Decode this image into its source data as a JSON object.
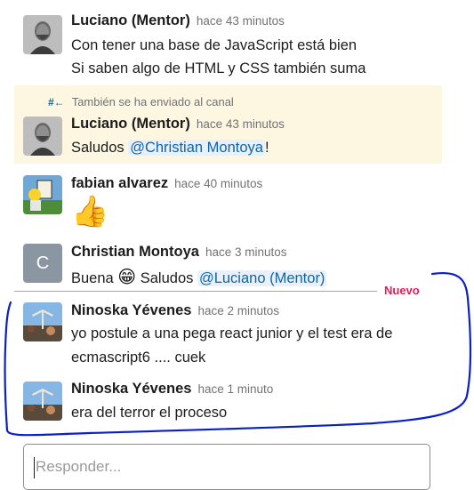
{
  "messages": [
    {
      "author": "Luciano (Mentor)",
      "time": "hace 43 minutos",
      "lines": [
        "Con tener una base de JavaScript está bien",
        "Si saben algo de HTML y CSS también suma"
      ],
      "avatar": "photo"
    },
    {
      "shared_note": "También se ha enviado al canal",
      "author": "Luciano (Mentor)",
      "time": "hace 43 minutos",
      "text_before": "Saludos ",
      "mention": "@Christian Montoya",
      "text_after": "!",
      "avatar": "photo",
      "highlighted": true
    },
    {
      "author": "fabian alvarez",
      "time": "hace 40 minutos",
      "emoji": "👍",
      "emoji_name": "thumbs-up-emoji",
      "avatar": "simpsons-photo"
    },
    {
      "author": "Christian Montoya",
      "time": "hace 3 minutos",
      "text_before": "Buena ",
      "emoji": "😁",
      "text_middle": " Saludos ",
      "mention": "@Luciano (Mentor)",
      "avatar_letter": "C",
      "avatar_color": "#8a97a3"
    },
    {
      "author": "Ninoska Yévenes",
      "time": "hace 2 minutos",
      "lines": [
        "yo postule a una pega react junior y el test era de",
        "ecmascript6 .... cuek"
      ],
      "avatar": "photo"
    },
    {
      "author": "Ninoska Yévenes",
      "time": "hace 1 minuto",
      "lines": [
        "era del terror el proceso"
      ],
      "avatar": "photo"
    }
  ],
  "new_divider_label": "Nuevo",
  "reply": {
    "placeholder": "Responder...",
    "value": ""
  },
  "colors": {
    "mention_text": "#1264a3",
    "mention_bg": "#e8f1fb",
    "new_divider": "#e01e5a",
    "highlight_bg": "#fdf6e1",
    "annotation_stroke": "#0a1fc4"
  }
}
